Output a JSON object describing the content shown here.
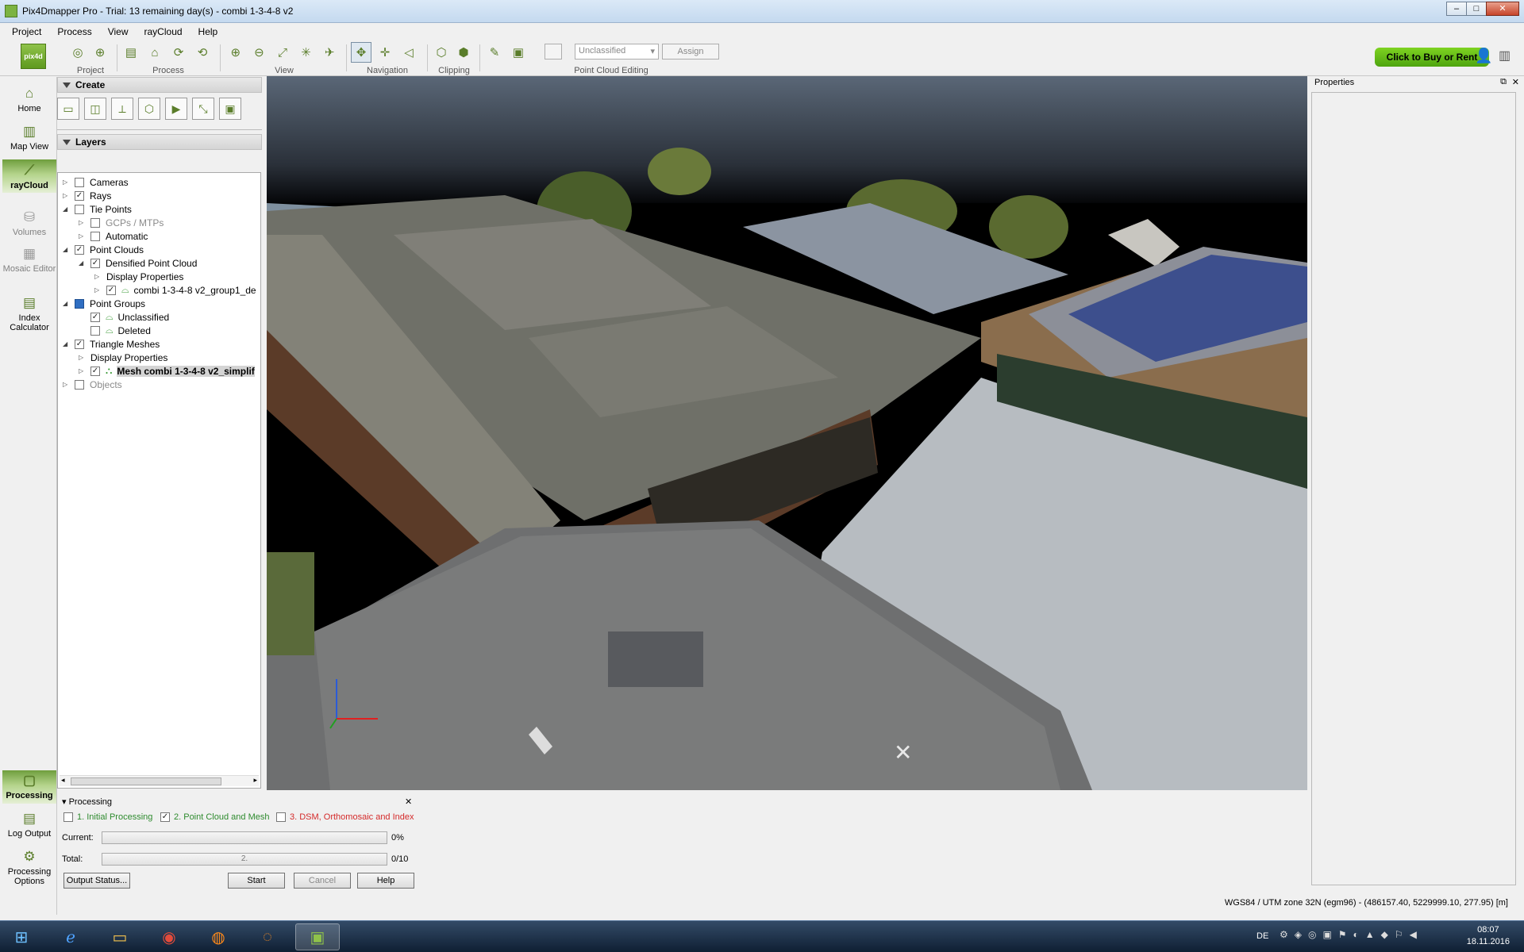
{
  "window": {
    "title": "Pix4Dmapper Pro - Trial: 13 remaining day(s) - combi 1-3-4-8 v2"
  },
  "menu": [
    "Project",
    "Process",
    "View",
    "rayCloud",
    "Help"
  ],
  "toolbar": {
    "groups": [
      "Project",
      "Process",
      "View",
      "Navigation",
      "Clipping",
      "Point Cloud Editing"
    ],
    "class_select": "Unclassified",
    "assign_label": "Assign",
    "buy_label": "Click to Buy or Rent"
  },
  "leftnav": [
    {
      "label": "Home",
      "icon": "home-icon"
    },
    {
      "label": "Map View",
      "icon": "map-icon"
    },
    {
      "label": "rayCloud",
      "icon": "raycloud-icon"
    },
    {
      "label": "Volumes",
      "icon": "volumes-icon"
    },
    {
      "label": "Mosaic Editor",
      "icon": "mosaic-editor-icon"
    },
    {
      "label": "Index Calculator",
      "icon": "index-calculator-icon"
    },
    {
      "label": "Processing",
      "icon": "processing-icon"
    },
    {
      "label": "Log Output",
      "icon": "log-output-icon"
    },
    {
      "label": "Processing Options",
      "icon": "gear-icon"
    }
  ],
  "create": {
    "title": "Create"
  },
  "layers": {
    "title": "Layers",
    "items": [
      {
        "label": "Cameras",
        "checked": false
      },
      {
        "label": "Rays",
        "checked": true
      },
      {
        "label": "Tie Points",
        "checked": false
      },
      {
        "label": "GCPs / MTPs",
        "checked": false
      },
      {
        "label": "Automatic",
        "checked": false
      },
      {
        "label": "Point Clouds",
        "checked": true
      },
      {
        "label": "Densified Point Cloud",
        "checked": true
      },
      {
        "label": "Display Properties"
      },
      {
        "label": "combi 1-3-4-8 v2_group1_de",
        "checked": true
      },
      {
        "label": "Point Groups",
        "checked": false
      },
      {
        "label": "Unclassified",
        "checked": true
      },
      {
        "label": "Deleted",
        "checked": false
      },
      {
        "label": "Triangle Meshes",
        "checked": true
      },
      {
        "label": "Display Properties"
      },
      {
        "label": "Mesh combi 1-3-4-8 v2_simplif",
        "checked": true
      },
      {
        "label": "Objects",
        "checked": false
      }
    ]
  },
  "properties": {
    "title": "Properties"
  },
  "processing": {
    "title": "Processing",
    "steps": [
      {
        "label": "1. Initial Processing",
        "checked": false,
        "color": "#2e8b2e"
      },
      {
        "label": "2. Point Cloud and Mesh",
        "checked": true,
        "color": "#2e8b2e"
      },
      {
        "label": "3. DSM, Orthomosaic and Index",
        "checked": false,
        "color": "#d42a2a"
      }
    ],
    "current_label": "Current:",
    "current_value": "0%",
    "total_label": "Total:",
    "total_bar_text": "2.",
    "total_value": "0/10",
    "buttons": {
      "output_status": "Output Status...",
      "start": "Start",
      "cancel": "Cancel",
      "help": "Help"
    }
  },
  "statusbar": {
    "coords": "WGS84 / UTM zone 32N (egm96) - (486157.40, 5229999.10, 277.95) [m]"
  },
  "taskbar": {
    "lang": "DE",
    "time": "08:07",
    "date": "18.11.2016"
  }
}
